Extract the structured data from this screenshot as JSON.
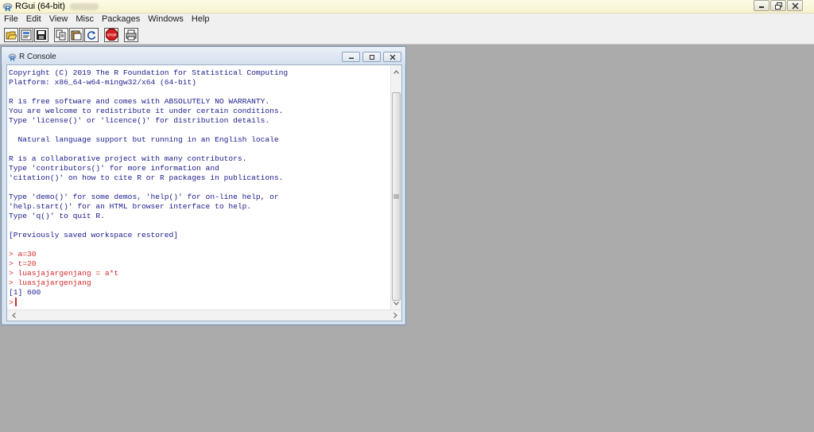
{
  "app": {
    "title": "RGui (64-bit)",
    "icon": "r-logo-icon"
  },
  "menu": {
    "items": [
      "File",
      "Edit",
      "View",
      "Misc",
      "Packages",
      "Windows",
      "Help"
    ]
  },
  "toolbar": {
    "buttons": [
      "open-script-icon",
      "load-workspace-icon",
      "save-workspace-icon",
      "copy-icon",
      "paste-icon",
      "copy-paste-icon",
      "stop-icon",
      "print-icon"
    ]
  },
  "console": {
    "title": "R Console",
    "lines": [
      {
        "text": "Copyright (C) 2019 The R Foundation for Statistical Computing",
        "kind": "out"
      },
      {
        "text": "Platform: x86_64-w64-mingw32/x64 (64-bit)",
        "kind": "out"
      },
      {
        "text": "",
        "kind": "out"
      },
      {
        "text": "R is free software and comes with ABSOLUTELY NO WARRANTY.",
        "kind": "out"
      },
      {
        "text": "You are welcome to redistribute it under certain conditions.",
        "kind": "out"
      },
      {
        "text": "Type 'license()' or 'licence()' for distribution details.",
        "kind": "out"
      },
      {
        "text": "",
        "kind": "out"
      },
      {
        "text": "  Natural language support but running in an English locale",
        "kind": "out"
      },
      {
        "text": "",
        "kind": "out"
      },
      {
        "text": "R is a collaborative project with many contributors.",
        "kind": "out"
      },
      {
        "text": "Type 'contributors()' for more information and",
        "kind": "out"
      },
      {
        "text": "'citation()' on how to cite R or R packages in publications.",
        "kind": "out"
      },
      {
        "text": "",
        "kind": "out"
      },
      {
        "text": "Type 'demo()' for some demos, 'help()' for on-line help, or",
        "kind": "out"
      },
      {
        "text": "'help.start()' for an HTML browser interface to help.",
        "kind": "out"
      },
      {
        "text": "Type 'q()' to quit R.",
        "kind": "out"
      },
      {
        "text": "",
        "kind": "out"
      },
      {
        "text": "[Previously saved workspace restored]",
        "kind": "out"
      },
      {
        "text": "",
        "kind": "out"
      },
      {
        "text": "> a=30",
        "kind": "cmd"
      },
      {
        "text": "> t=20",
        "kind": "cmd"
      },
      {
        "text": "> luasjajargenjang = a*t",
        "kind": "cmd"
      },
      {
        "text": "> luasjajargenjang",
        "kind": "cmd"
      },
      {
        "text": "[1] 600",
        "kind": "out"
      }
    ],
    "prompt": ">"
  },
  "colors": {
    "output_text": "#1c1c8c",
    "command_text": "#d42a2a",
    "desktop_bg": "#ababab",
    "titlebar_bg": "#f7f3cf"
  }
}
